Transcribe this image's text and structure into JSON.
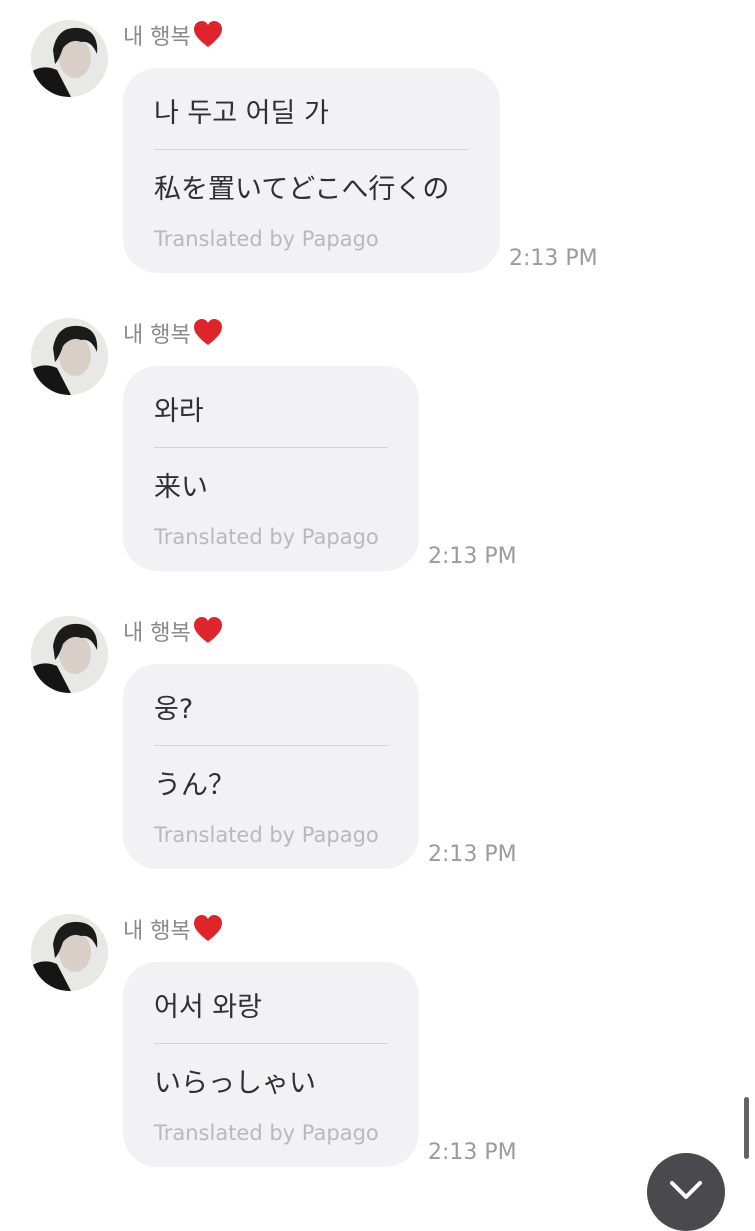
{
  "messages": [
    {
      "sender": "내 행복",
      "original": "나 두고 어딜 가",
      "translation": "私を置いてどこへ行くの",
      "credit": "Translated by Papago",
      "time": "2:13 PM"
    },
    {
      "sender": "내 행복",
      "original": "와라",
      "translation": "来い",
      "credit": "Translated by Papago",
      "time": "2:13 PM"
    },
    {
      "sender": "내 행복",
      "original": "웅?",
      "translation": "うん？",
      "credit": "Translated by Papago",
      "time": "2:13 PM"
    },
    {
      "sender": "내 행복",
      "original": "어서 와랑",
      "translation": "いらっしゃい",
      "credit": "Translated by Papago",
      "time": "2:13 PM"
    }
  ],
  "icons": {
    "heart": "heart-icon",
    "scroll_down": "chevron-down-icon"
  },
  "colors": {
    "bubble": "#f2f2f4",
    "heart": "#e0242b",
    "scroll_button": "#4a4a4e"
  }
}
